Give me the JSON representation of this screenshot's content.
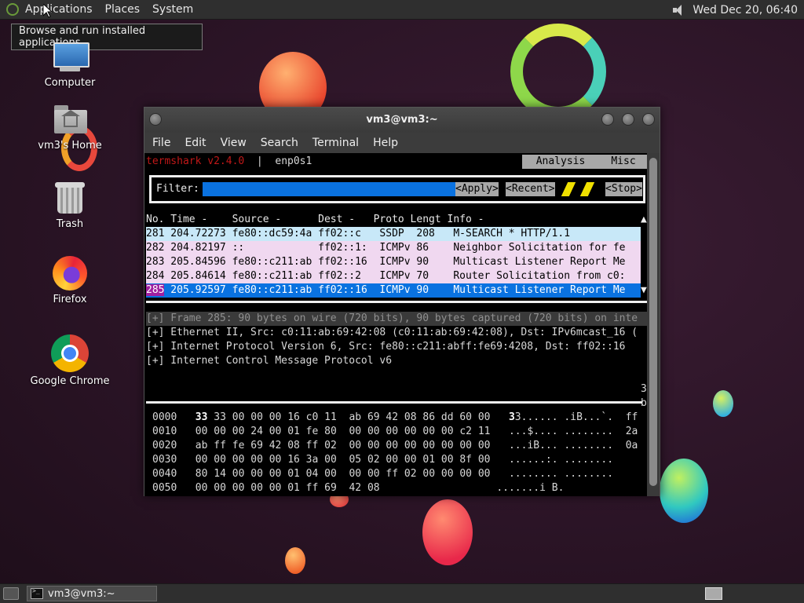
{
  "top_panel": {
    "menus": [
      "Applications",
      "Places",
      "System"
    ],
    "clock": "Wed Dec 20, 06:40",
    "tooltip": "Browse and run installed applications"
  },
  "desktop": {
    "icons": [
      {
        "label": "Computer",
        "icon": "computer-icon"
      },
      {
        "label": "vm3's Home",
        "icon": "home-folder-icon"
      },
      {
        "label": "Trash",
        "icon": "trash-icon"
      },
      {
        "label": "Firefox",
        "icon": "firefox-icon"
      },
      {
        "label": "Google Chrome",
        "icon": "chrome-icon"
      }
    ]
  },
  "window": {
    "title": "vm3@vm3:~",
    "menu": [
      "File",
      "Edit",
      "View",
      "Search",
      "Terminal",
      "Help"
    ]
  },
  "termshark": {
    "app_name": "termshark v2.4.0",
    "separator": "|",
    "interface": "enp0s1",
    "tabs": [
      "Analysis",
      "Misc"
    ],
    "filter_label": "Filter:",
    "apply_label": "<Apply>",
    "recent_label": "<Recent>",
    "stop_label": "<Stop>",
    "columns": "No. Time -    Source -      Dest -   Proto Lengt Info -",
    "up_arrow": "▲",
    "down_arrow": "▼",
    "packets": [
      {
        "text": "281 204.72273 fe80::dc59:4a ff02::c   SSDP  208   M-SEARCH * HTTP/1.1"
      },
      {
        "text": "282 204.82197 ::            ff02::1:  ICMPv 86    Neighbor Solicitation for fe"
      },
      {
        "text": "283 205.84596 fe80::c211:ab ff02::16  ICMPv 90    Multicast Listener Report Me"
      },
      {
        "text": "284 205.84614 fe80::c211:ab ff02::2   ICMPv 70    Router Solicitation from c0:"
      }
    ],
    "selected_packet": {
      "no": "285",
      "rest": " 205.92597 fe80::c211:ab ff02::16  ICMPv 90    Multicast Listener Report Me"
    },
    "details": [
      "[+] Frame 285: 90 bytes on wire (720 bits), 90 bytes captured (720 bits) on inte",
      "[+] Ethernet II, Src: c0:11:ab:69:42:08 (c0:11:ab:69:42:08), Dst: IPv6mcast_16 (",
      "[+] Internet Protocol Version 6, Src: fe80::c211:abff:fe69:4208, Dst: ff02::16",
      "[+] Internet Control Message Protocol v6"
    ],
    "detail_side": [
      "3",
      "b"
    ],
    "hex": [
      {
        "offset": "0000",
        "first": "33",
        "bytes": " 33 00 00 00 16 c0 11  ab 69 42 08 86 dd 60 00",
        "ascii_first": "3",
        "ascii": "3...... .iB...`.",
        "side": "ff"
      },
      {
        "offset": "0010",
        "first": "",
        "bytes": "00 00 00 24 00 01 fe 80  00 00 00 00 00 00 c2 11",
        "ascii_first": "",
        "ascii": "...$.... ........",
        "side": "2a"
      },
      {
        "offset": "0020",
        "first": "",
        "bytes": "ab ff fe 69 42 08 ff 02  00 00 00 00 00 00 00 00",
        "ascii_first": "",
        "ascii": "...iB... ........",
        "side": "0a"
      },
      {
        "offset": "0030",
        "first": "",
        "bytes": "00 00 00 00 00 16 3a 00  05 02 00 00 01 00 8f 00",
        "ascii_first": "",
        "ascii": "......:. ........",
        "side": ""
      },
      {
        "offset": "0040",
        "first": "",
        "bytes": "80 14 00 00 00 01 04 00  00 00 ff 02 00 00 00 00",
        "ascii_first": "",
        "ascii": "........ ........",
        "side": ""
      },
      {
        "offset": "0050",
        "first": "",
        "bytes": "00 00 00 00 00 01 ff 69  42 08",
        "ascii_first": "",
        "ascii": ".......i B.",
        "side": ""
      }
    ]
  },
  "taskbar": {
    "window_button": "vm3@vm3:~"
  },
  "colors": {
    "selected_row": "#0a72e0",
    "termshark_red": "#c01818",
    "filter_input": "#0a72e0",
    "stripe": "#f0e000"
  }
}
